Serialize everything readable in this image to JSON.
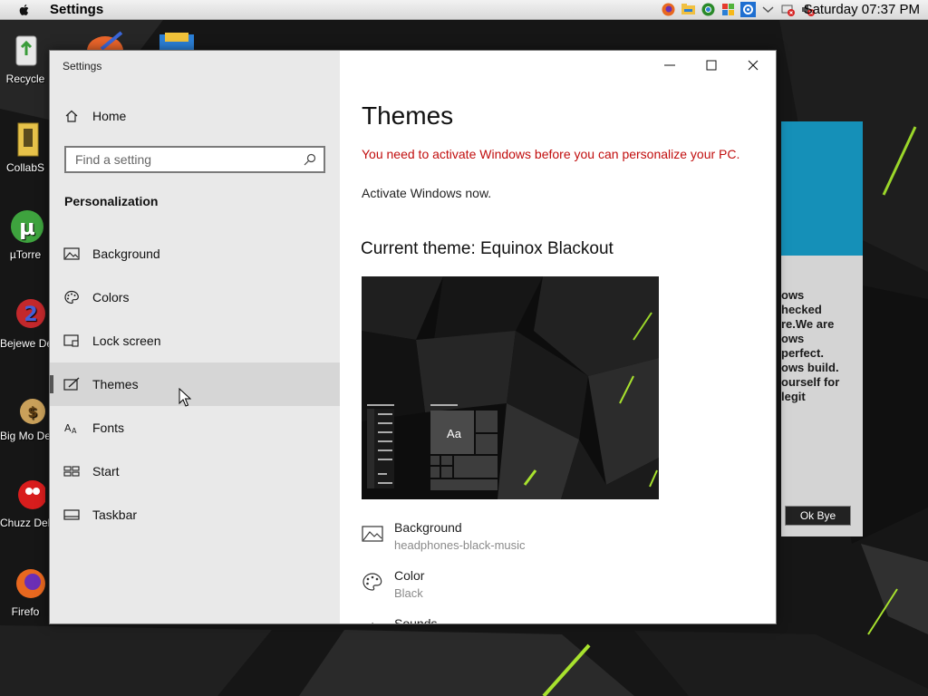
{
  "menubar": {
    "app_name": "Settings",
    "clock": "Saturday 07:37 PM"
  },
  "desktop": {
    "icons": [
      {
        "label": "Recycle",
        "icon": "recycle-bin-icon"
      },
      {
        "label": "CollabS",
        "icon": "folder-icon"
      },
      {
        "label": "µTorre",
        "icon": "utorrent-icon"
      },
      {
        "label": "Bejewe Delux",
        "icon": "bejeweled-icon"
      },
      {
        "label": "Big Mo Delux",
        "icon": "money-bag-icon"
      },
      {
        "label": "Chuzz Delux",
        "icon": "chuzzle-icon"
      },
      {
        "label": "Firefo",
        "icon": "firefox-icon"
      }
    ]
  },
  "background_dialog": {
    "message_lines": [
      "ows",
      "hecked",
      "re.We are",
      "ows",
      "perfect.",
      "ows build.",
      "ourself for",
      "legit"
    ],
    "button_label": "Ok Bye",
    "band_color": "#1590b8"
  },
  "settings": {
    "window_title": "Settings",
    "home_label": "Home",
    "search": {
      "placeholder": "Find a setting",
      "value": ""
    },
    "section_title": "Personalization",
    "nav_items": [
      {
        "label": "Background",
        "icon": "picture-icon"
      },
      {
        "label": "Colors",
        "icon": "palette-icon"
      },
      {
        "label": "Lock screen",
        "icon": "lock-screen-icon"
      },
      {
        "label": "Themes",
        "icon": "brush-icon",
        "active": true
      },
      {
        "label": "Fonts",
        "icon": "font-icon"
      },
      {
        "label": "Start",
        "icon": "start-icon"
      },
      {
        "label": "Taskbar",
        "icon": "taskbar-icon"
      }
    ],
    "content": {
      "title": "Themes",
      "warning": "You need to activate Windows before you can personalize your PC.",
      "activate_link": "Activate Windows now.",
      "current_theme": "Current theme: Equinox Blackout",
      "preview_text": "Aa",
      "properties": [
        {
          "name": "Background",
          "value": "headphones-black-music",
          "icon": "picture-icon"
        },
        {
          "name": "Color",
          "value": "Black",
          "icon": "palette-icon"
        },
        {
          "name": "Sounds",
          "value": "",
          "icon": "sound-icon"
        }
      ]
    },
    "colors": {
      "warning": "#c10d0d",
      "sidebar_bg": "#e9e9e9",
      "active_item_bg": "#d6d6d6"
    }
  }
}
